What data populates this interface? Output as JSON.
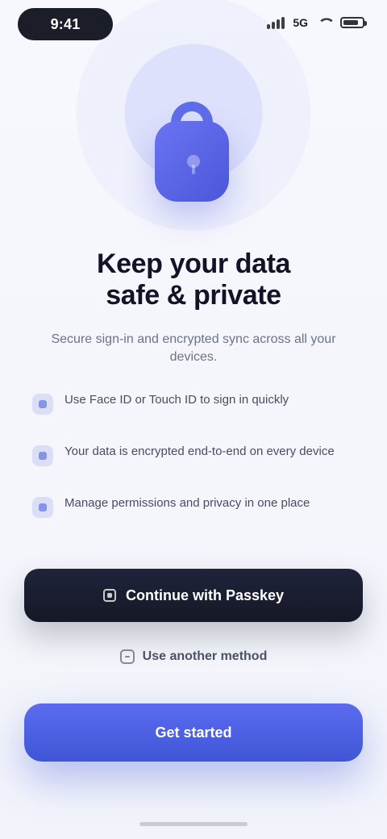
{
  "status_bar": {
    "time": "9:41",
    "network": "5G"
  },
  "hero": {
    "title_line_1": "Keep your data",
    "title_line_2": "safe & private",
    "subtitle": "Secure sign-in and encrypted sync across all your devices."
  },
  "bullets": [
    {
      "text": "Use Face ID or Touch ID to sign in quickly"
    },
    {
      "text": "Your data is encrypted end-to-end on every device"
    },
    {
      "text": "Manage permissions and privacy in one place"
    }
  ],
  "actions": {
    "primary_dark_label": "Continue with Passkey",
    "secondary_link_label": "Use another method",
    "accent_label": "Get started"
  }
}
